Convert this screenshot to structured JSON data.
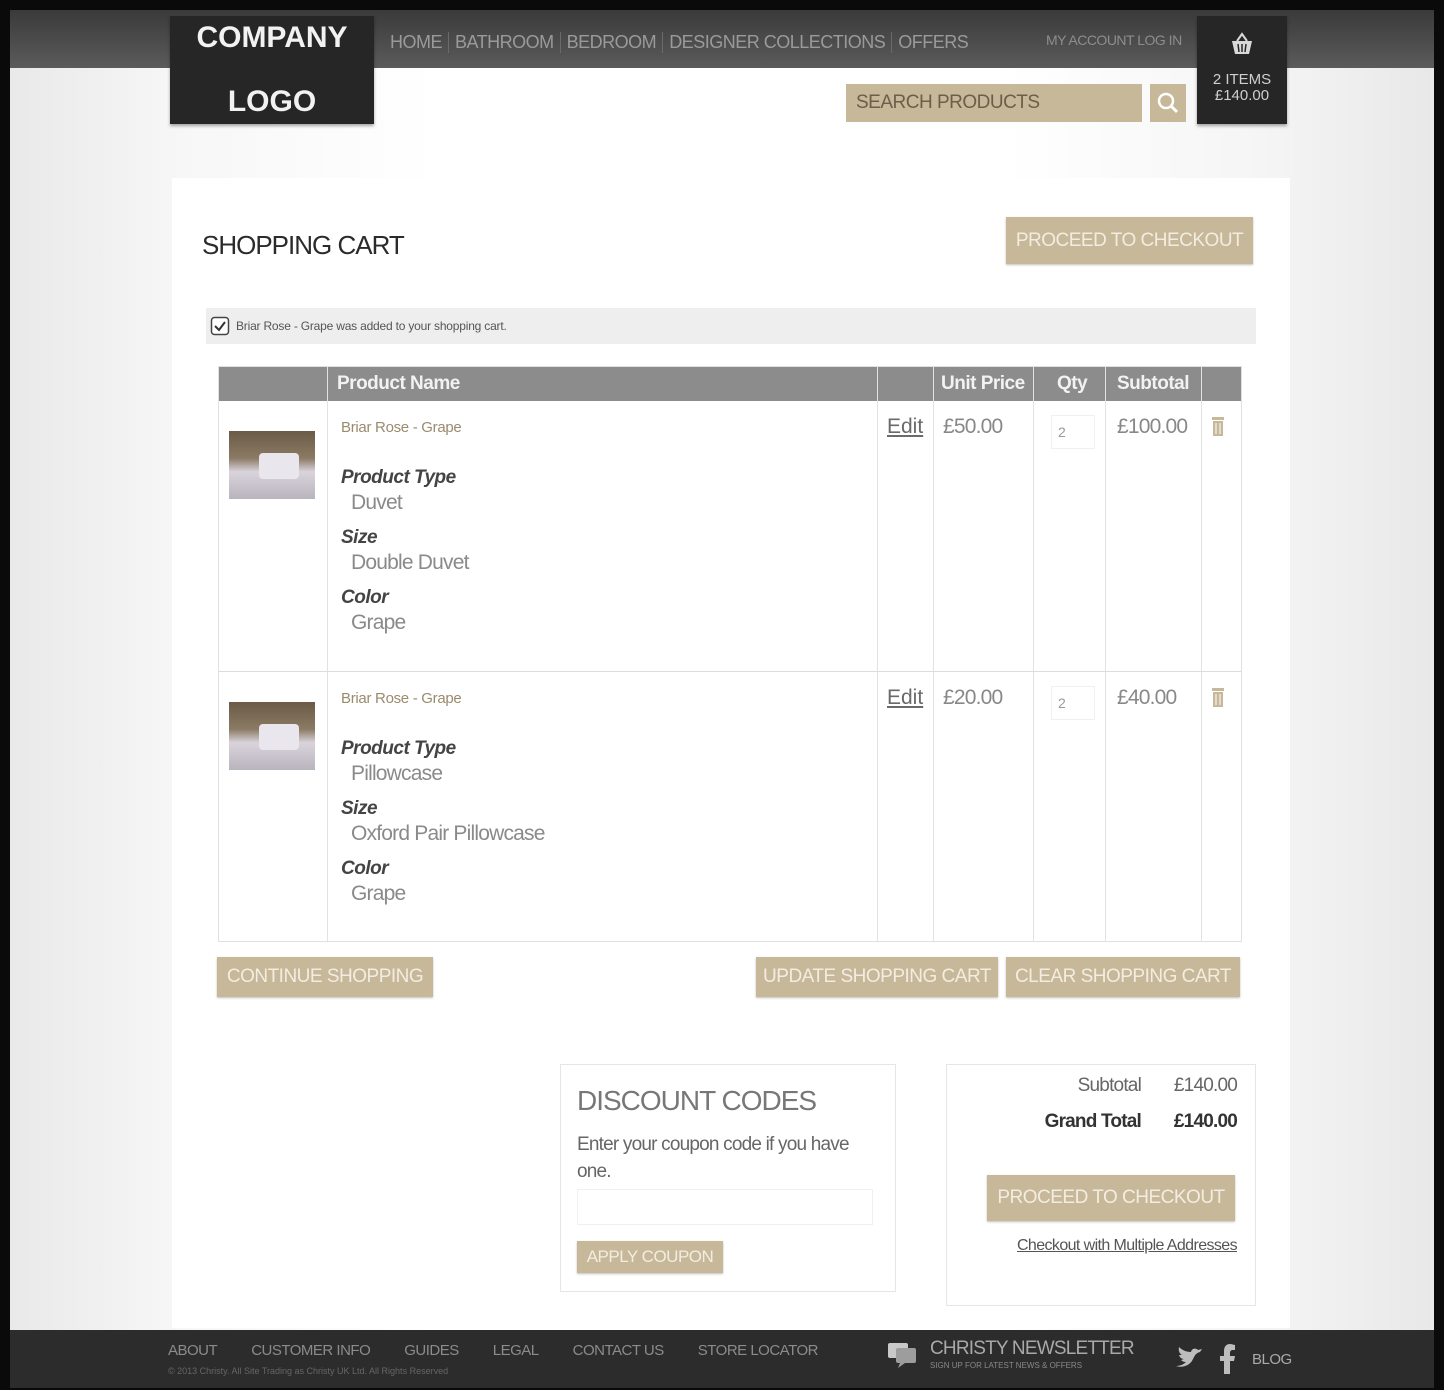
{
  "header": {
    "logo_line1": "COMPANY",
    "logo_line2": "LOGO",
    "nav": [
      "HOME",
      "BATHROOM",
      "BEDROOM",
      "DESIGNER COLLECTIONS",
      "OFFERS"
    ],
    "account": "MY ACCOUNT  LOG IN",
    "cart_items": "2 ITEMS",
    "cart_total": "£140.00",
    "search_placeholder": "SEARCH PRODUCTS"
  },
  "cart": {
    "title": "SHOPPING CART",
    "checkout_label": "PROCEED TO CHECKOUT",
    "message": "Briar Rose - Grape was added to your shopping cart.",
    "columns": [
      "Product Name",
      "Unit Price",
      "Qty",
      "Subtotal"
    ],
    "edit_label": "Edit",
    "items": [
      {
        "name": "Briar Rose - Grape",
        "options": [
          {
            "label": "Product Type",
            "value": "Duvet"
          },
          {
            "label": "Size",
            "value": "Double Duvet"
          },
          {
            "label": "Color",
            "value": "Grape"
          }
        ],
        "unit_price": "£50.00",
        "qty": "2",
        "subtotal": "£100.00"
      },
      {
        "name": "Briar Rose - Grape",
        "options": [
          {
            "label": "Product Type",
            "value": "Pillowcase"
          },
          {
            "label": "Size",
            "value": "Oxford Pair Pillowcase"
          },
          {
            "label": "Color",
            "value": "Grape"
          }
        ],
        "unit_price": "£20.00",
        "qty": "2",
        "subtotal": "£40.00"
      }
    ],
    "continue_label": "CONTINUE SHOPPING",
    "update_label": "UPDATE SHOPPING CART",
    "clear_label": "CLEAR SHOPPING CART"
  },
  "discount": {
    "title": "DISCOUNT CODES",
    "description": "Enter your coupon code if you have one.",
    "apply_label": "APPLY COUPON"
  },
  "totals": {
    "subtotal_label": "Subtotal",
    "subtotal_value": "£140.00",
    "grand_total_label": "Grand Total",
    "grand_total_value": "£140.00",
    "checkout_label": "PROCEED TO CHECKOUT",
    "multi_address_label": "Checkout with Multiple Addresses"
  },
  "footer": {
    "nav": [
      "ABOUT",
      "CUSTOMER INFO",
      "GUIDES",
      "LEGAL",
      "CONTACT US",
      "STORE LOCATOR"
    ],
    "copyright": "© 2013 Christy. All Site Trading as Christy UK Ltd. All Rights Reserved",
    "newsletter_title": "CHRISTY NEWSLETTER",
    "newsletter_sub": "SIGN UP FOR LATEST NEWS & OFFERS",
    "blog_label": "BLOG"
  },
  "colors": {
    "accent": "#c7b899",
    "dark": "#262626",
    "table_header": "#8c8c8c"
  },
  "icons": [
    "basket-icon",
    "search-icon",
    "check-icon",
    "trash-icon",
    "chat-icon",
    "twitter-icon",
    "facebook-icon"
  ]
}
